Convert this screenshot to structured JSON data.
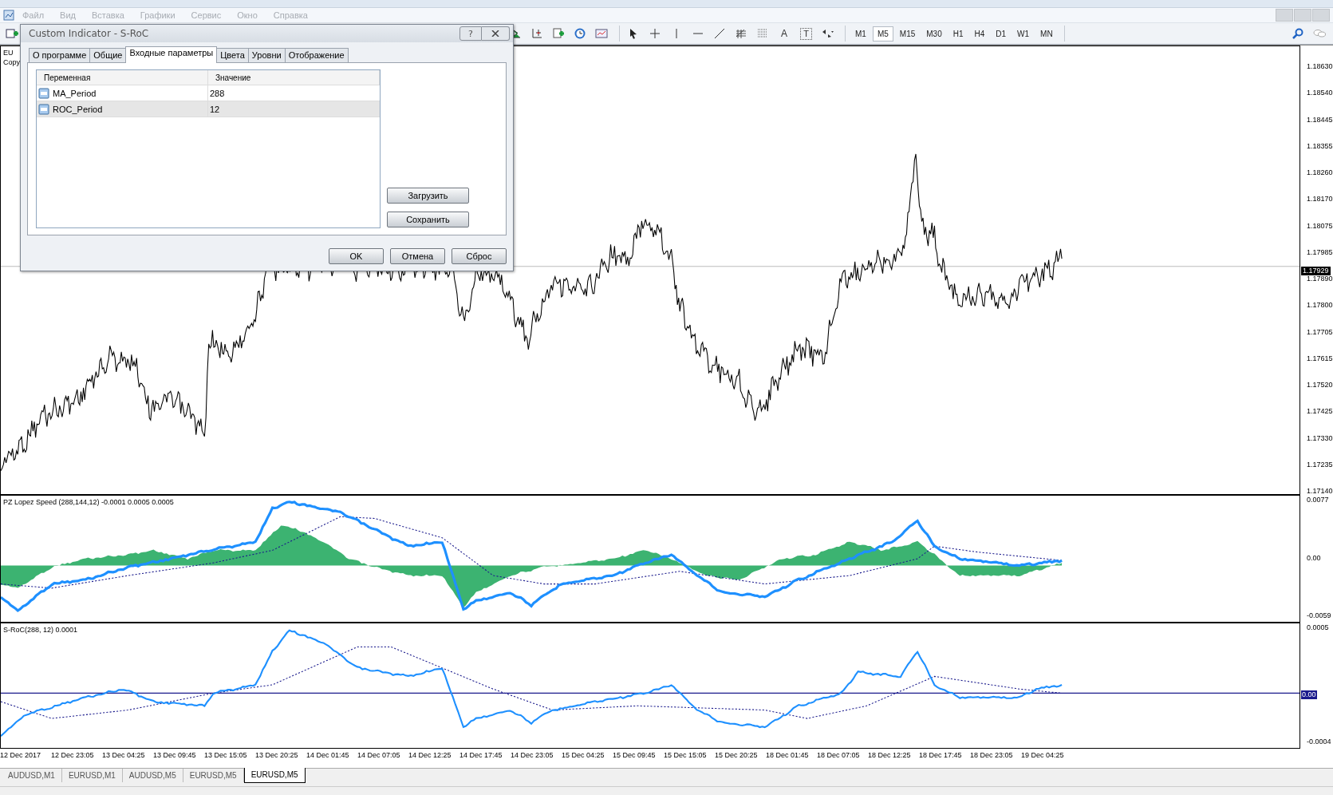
{
  "menu": [
    {
      "label": "Файл",
      "disabled": true
    },
    {
      "label": "Вид",
      "disabled": true
    },
    {
      "label": "Вставка",
      "disabled": true
    },
    {
      "label": "Графики",
      "disabled": true
    },
    {
      "label": "Сервис",
      "disabled": true
    },
    {
      "label": "Окно",
      "disabled": true
    },
    {
      "label": "Справка",
      "disabled": true
    }
  ],
  "toolbar": {
    "text_tool": "A",
    "label_tool": "T",
    "timeframes": [
      {
        "label": "M1",
        "selected": false
      },
      {
        "label": "M5",
        "selected": true
      },
      {
        "label": "M15",
        "selected": false
      },
      {
        "label": "M30",
        "selected": false
      },
      {
        "label": "H1",
        "selected": false
      },
      {
        "label": "H4",
        "selected": false
      },
      {
        "label": "D1",
        "selected": false
      },
      {
        "label": "W1",
        "selected": false
      },
      {
        "label": "MN",
        "selected": false
      }
    ]
  },
  "chart": {
    "symbol_label": "EU",
    "copyright_label": "Copy",
    "price_axis": [
      "1.18630",
      "1.18540",
      "1.18445",
      "1.18355",
      "1.18260",
      "1.18170",
      "1.18075",
      "1.17985",
      "1.17890",
      "1.17800",
      "1.17705",
      "1.17615",
      "1.17520",
      "1.17425",
      "1.17330",
      "1.17235",
      "1.17140"
    ],
    "current_price": "1.17929",
    "indicator_1": {
      "label": "PZ Lopez Speed (288,144,12) -0.0001 0.0005 0.0005",
      "axis": [
        "0.0077",
        "0.00",
        "-0.0059"
      ]
    },
    "indicator_2": {
      "label": "S-RoC(288, 12) 0.0001",
      "axis": [
        "0.0005",
        "-0.0004"
      ],
      "zero_label": "0.00"
    },
    "time_axis": [
      "12 Dec 2017",
      "12 Dec 23:05",
      "13 Dec 04:25",
      "13 Dec 09:45",
      "13 Dec 15:05",
      "13 Dec 20:25",
      "14 Dec 01:45",
      "14 Dec 07:05",
      "14 Dec 12:25",
      "14 Dec 17:45",
      "14 Dec 23:05",
      "15 Dec 04:25",
      "15 Dec 09:45",
      "15 Dec 15:05",
      "15 Dec 20:25",
      "18 Dec 01:45",
      "18 Dec 07:05",
      "18 Dec 12:25",
      "18 Dec 17:45",
      "18 Dec 23:05",
      "19 Dec 04:25"
    ]
  },
  "chart_tabs": [
    {
      "label": "AUDUSD,M1",
      "selected": false
    },
    {
      "label": "EURUSD,M1",
      "selected": false
    },
    {
      "label": "AUDUSD,M5",
      "selected": false
    },
    {
      "label": "EURUSD,M5",
      "selected": false
    },
    {
      "label": "EURUSD,M5",
      "selected": true
    }
  ],
  "dialog": {
    "title": "Custom Indicator - S-RoC",
    "help_button": "?",
    "tabs": [
      {
        "label": "О программе",
        "selected": false
      },
      {
        "label": "Общие",
        "selected": false
      },
      {
        "label": "Входные параметры",
        "selected": true
      },
      {
        "label": "Цвета",
        "selected": false
      },
      {
        "label": "Уровни",
        "selected": false
      },
      {
        "label": "Отображение",
        "selected": false
      }
    ],
    "table": {
      "columns": [
        "Переменная",
        "Значение"
      ],
      "rows": [
        {
          "variable": "MA_Period",
          "value": "288",
          "selected": false
        },
        {
          "variable": "ROC_Period",
          "value": "12",
          "selected": true
        }
      ]
    },
    "side_buttons": [
      "Загрузить",
      "Сохранить"
    ],
    "buttons": [
      "OK",
      "Отмена",
      "Сброс"
    ]
  }
}
